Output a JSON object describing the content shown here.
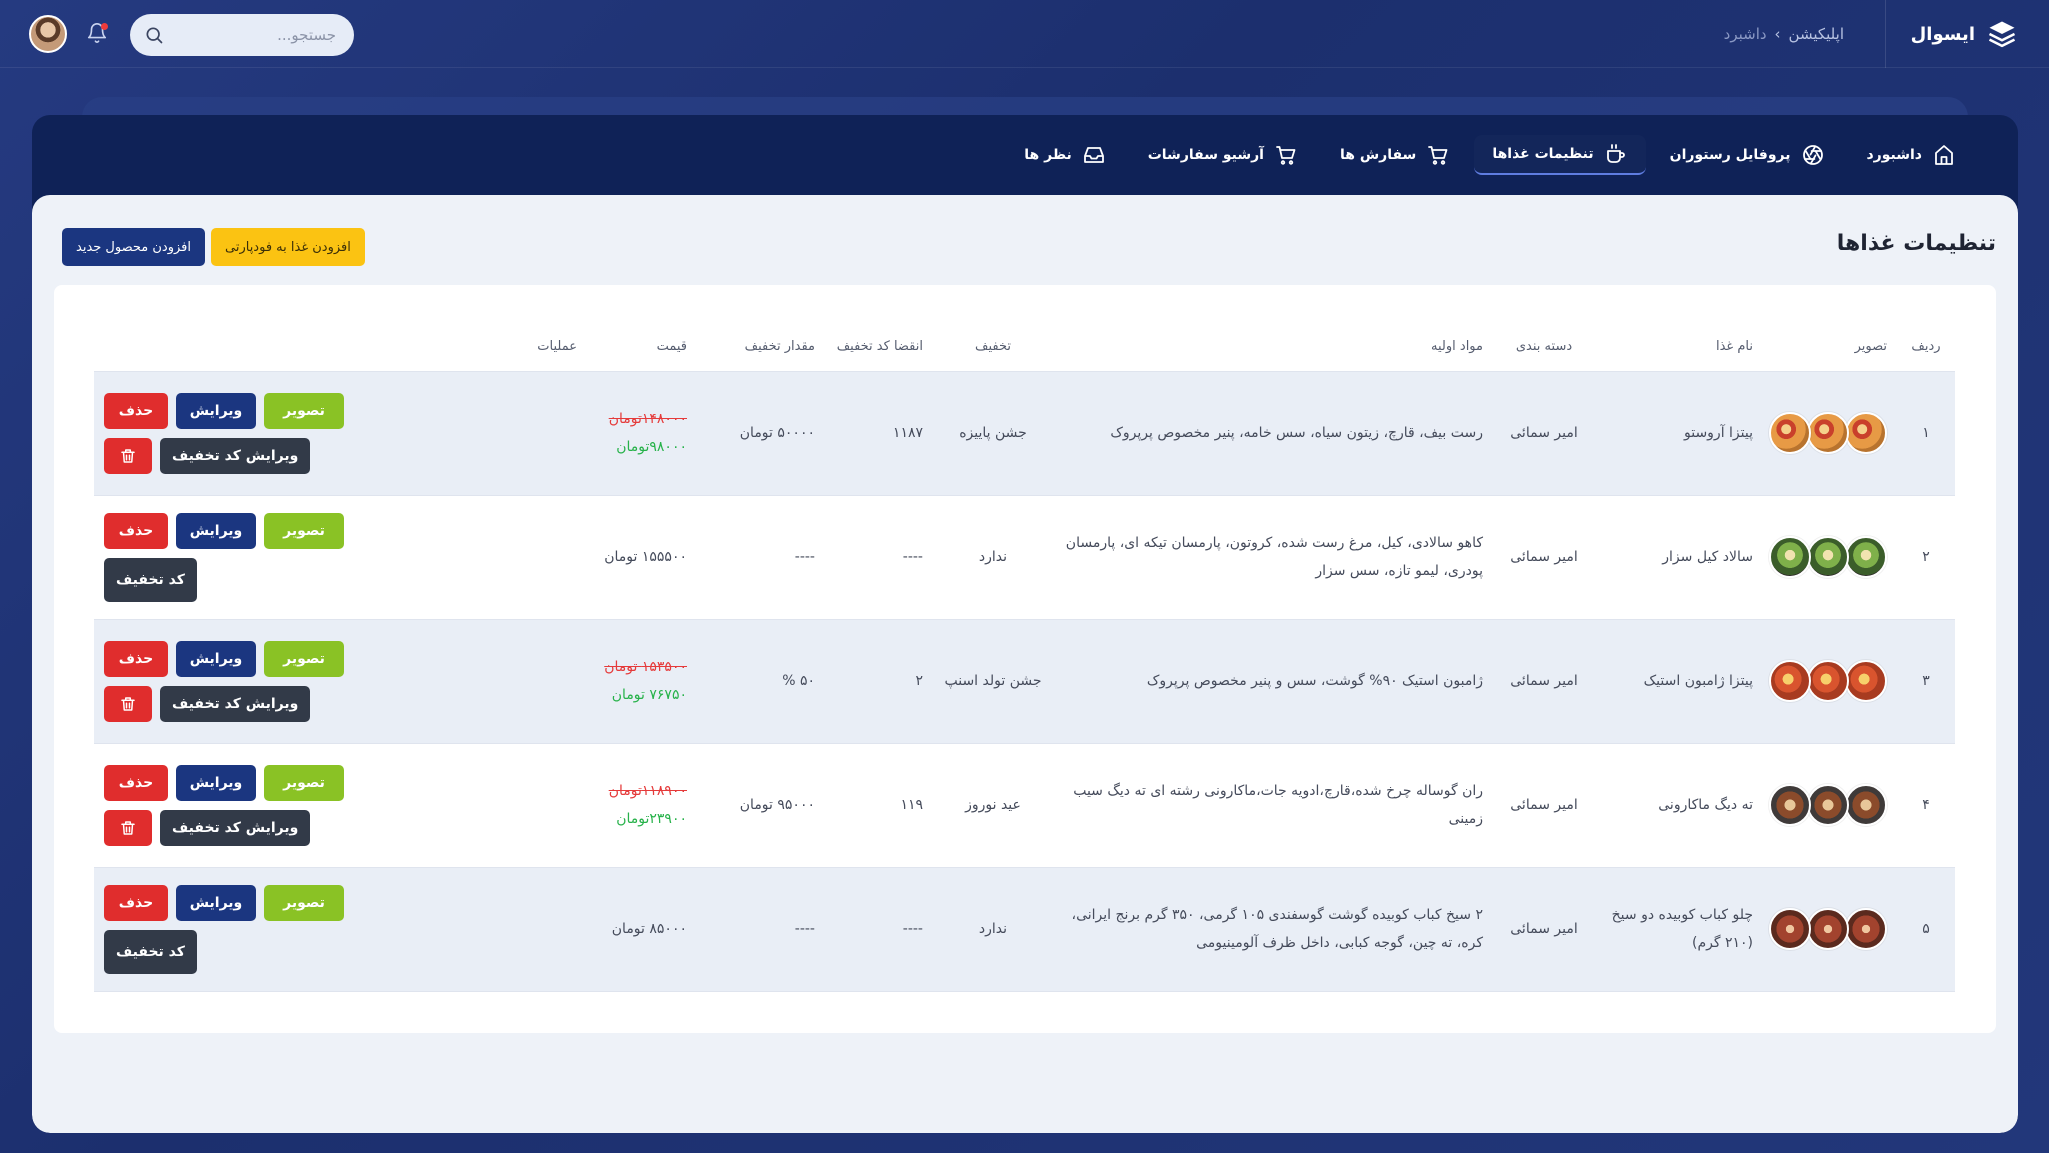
{
  "header": {
    "brand": "ایسوال",
    "breadcrumb": [
      "اپلیکیشن",
      "داشبرد"
    ],
    "search_placeholder": "جستجو..."
  },
  "nav": [
    {
      "label": "داشبورد",
      "icon": "home-icon"
    },
    {
      "label": "پروفایل رستوران",
      "icon": "aperture-icon"
    },
    {
      "label": "تنظیمات غذاها",
      "icon": "cup-icon",
      "active": true
    },
    {
      "label": "سفارش ها",
      "icon": "cart-icon"
    },
    {
      "label": "آرشیو سفارشات",
      "icon": "cart-icon"
    },
    {
      "label": "نظر ها",
      "icon": "inbox-icon"
    }
  ],
  "page": {
    "title": "تنظیمات غذاها",
    "add_to_foodparty": "افزودن غذا به فودپارتی",
    "add_new_product": "افزودن محصول جدید"
  },
  "table": {
    "headers": [
      "ردیف",
      "تصویر",
      "نام غذا",
      "دسته بندی",
      "مواد اولیه",
      "تخفیف",
      "انقضا کد تخفیف",
      "مقدار تخفیف",
      "قیمت",
      "عملیات"
    ],
    "ops": {
      "image": "تصویر",
      "edit": "ویرایش",
      "delete": "حذف",
      "edit_discount": "ویرایش کد تخفیف",
      "discount_code": "کد تخفیف"
    },
    "rows": [
      {
        "idx": "۱",
        "thumb": "t-pizza",
        "name": "پیتزا آروستو",
        "category": "امیر سمائی",
        "ingredients": "رست بیف، قارچ، زیتون سیاه، سس خامه، پنیر مخصوص پرپروک",
        "discount": "جشن پاییزه",
        "expiry": "۱۱۸۷",
        "amount": "۵۰۰۰۰ تومان",
        "price_old": "۱۴۸۰۰۰تومان",
        "price_new": "۹۸۰۰۰تومان",
        "has_discount": true
      },
      {
        "idx": "۲",
        "thumb": "t-salad",
        "name": "سالاد کیل سزار",
        "category": "امیر سمائی",
        "ingredients": "کاهو سالادی، کیل، مرغ رست شده، کروتون، پارمسان تیکه ای، پارمسان پودری، لیمو تازه، سس سزار",
        "discount": "ندارد",
        "expiry": "----",
        "amount": "----",
        "price": "۱۵۵۵۰۰ تومان",
        "has_discount": false
      },
      {
        "idx": "۳",
        "thumb": "t-zambon",
        "name": "پیتزا ژامبون استیک",
        "category": "امیر سمائی",
        "ingredients": "ژامبون استیک ۹۰% گوشت، سس و پنیر مخصوص پرپروک",
        "discount": "جشن تولد اسنپ",
        "expiry": "۲",
        "amount": "۵۰ %",
        "price_old": "۱۵۳۵۰۰ تومان",
        "price_new": "۷۶۷۵۰ تومان",
        "has_discount": true
      },
      {
        "idx": "۴",
        "thumb": "t-mac",
        "name": "ته دیگ ماکارونی",
        "category": "امیر سمائی",
        "ingredients": "ران گوساله چرخ شده،قارچ،ادویه جات،ماکارونی رشته ای ته دیگ سیب زمینی",
        "discount": "عید نوروز",
        "expiry": "۱۱۹",
        "amount": "۹۵۰۰۰ تومان",
        "price_old": "۱۱۸۹۰۰تومان",
        "price_new": "۲۳۹۰۰تومان",
        "has_discount": true
      },
      {
        "idx": "۵",
        "thumb": "t-kebab",
        "name": "چلو کباب کوبیده دو سیخ (۲۱۰ گرم)",
        "category": "امیر سمائی",
        "ingredients": "۲ سیخ کباب کوبیده گوشت گوسفندی ۱۰۵ گرمی، ۳۵۰ گرم برنج ایرانی، کره، ته چین، گوجه کبابی، داخل ظرف آلومینیومی",
        "discount": "ندارد",
        "expiry": "----",
        "amount": "----",
        "price": "۸۵۰۰۰ تومان",
        "has_discount": false
      }
    ]
  },
  "colors": {
    "background": "#1e3273",
    "frame": "#0f2257",
    "content": "#eef2f8",
    "green": "#8ac225",
    "blue": "#1b3680",
    "red": "#e02d2d",
    "yellow": "#fbc312"
  }
}
